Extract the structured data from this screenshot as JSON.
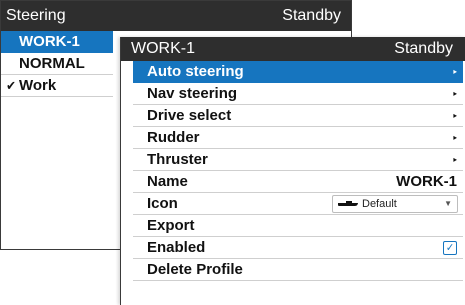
{
  "steering": {
    "title": "Steering",
    "status": "Standby",
    "items": [
      {
        "label": "WORK-1",
        "check": ""
      },
      {
        "label": "NORMAL",
        "check": ""
      },
      {
        "label": "Work",
        "check": "✔"
      }
    ]
  },
  "profile": {
    "title": "WORK-1",
    "status": "Standby",
    "menu": [
      {
        "label": "Auto steering",
        "arrow": "▸"
      },
      {
        "label": "Nav steering",
        "arrow": "▸"
      },
      {
        "label": "Drive select",
        "arrow": "▸"
      },
      {
        "label": "Rudder",
        "arrow": "▸"
      },
      {
        "label": "Thruster",
        "arrow": "▸"
      }
    ],
    "name_label": "Name",
    "name_value": "WORK-1",
    "icon_label": "Icon",
    "icon_value": "Default",
    "export_label": "Export",
    "enabled_label": "Enabled",
    "enabled_check": "✓",
    "delete_label": "Delete Profile"
  },
  "colors": {
    "title_bar": "#2e2e2e",
    "selection": "#1675bf"
  }
}
